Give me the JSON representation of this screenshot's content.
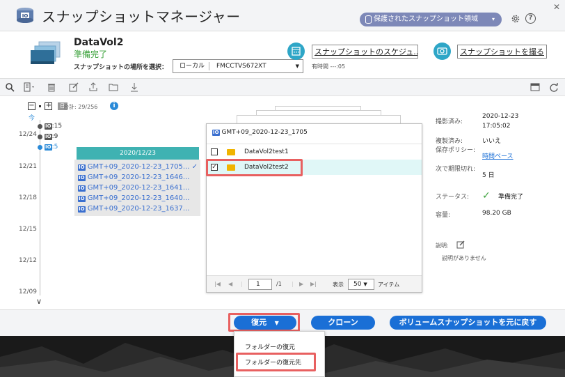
{
  "window": {
    "title": "スナップショットマネージャー",
    "protected_region_label": "保護されたスナップショット領域"
  },
  "volume": {
    "name": "DataVol2",
    "status": "準備完了",
    "location_label": "スナップショットの場所を選択：",
    "location_type": "ローカル",
    "location_device": "FMCCTVS672XT",
    "time_label": "有時間 ---:05",
    "schedule_button": "スナップショットのスケジュ...",
    "take_button": "スナップショットを撮る"
  },
  "timeline": {
    "total": "合計: 29/256",
    "now": "今",
    "dates": [
      "12/24",
      "12/21",
      "12/18",
      "12/15",
      "12/12",
      "12/09"
    ],
    "tags": [
      ":15",
      ":9",
      ":5"
    ]
  },
  "group": {
    "date": "2020/12/23",
    "snapshots": [
      "GMT+09_2020-12-23_1705...",
      "GMT+09_2020-12-23_1646...",
      "GMT+09_2020-12-23_1641...",
      "GMT+09_2020-12-23_1640...",
      "GMT+09_2020-12-23_1637..."
    ]
  },
  "browser": {
    "title": "GMT+09_2020-12-23_1705",
    "folders": [
      {
        "name": "DataVol2test1",
        "checked": false
      },
      {
        "name": "DataVol2test2",
        "checked": true
      }
    ],
    "page": "1",
    "page_total": "/1",
    "show_label": "表示",
    "per_page": "50",
    "items_label": "アイテム"
  },
  "details": {
    "taken_label": "撮影済み:",
    "taken_date": "2020-12-23",
    "taken_time": "17:05:02",
    "replicated_label": "複製済み:",
    "replicated_value": "いいえ",
    "policy_label": "保存ポリシー:",
    "policy_value": "時間ベース",
    "expire_label": "次で期限切れ:",
    "expire_value": "5 日",
    "status_label": "ステータス:",
    "status_value": "準備完了",
    "capacity_label": "容量:",
    "capacity_value": "98.20 GB",
    "desc_label": "説明:",
    "desc_value": "説明がありません"
  },
  "actions": {
    "restore": "復元",
    "clone": "クローン",
    "revert": "ボリュームスナップショットを元に戻す",
    "restore_menu": [
      "フォルダーの復元",
      "フォルダーの復元先"
    ]
  },
  "colors": {
    "accent": "#1a6fd6",
    "teal": "#3fb2b2",
    "ok": "#3aa13a",
    "highlight": "#e86060"
  }
}
